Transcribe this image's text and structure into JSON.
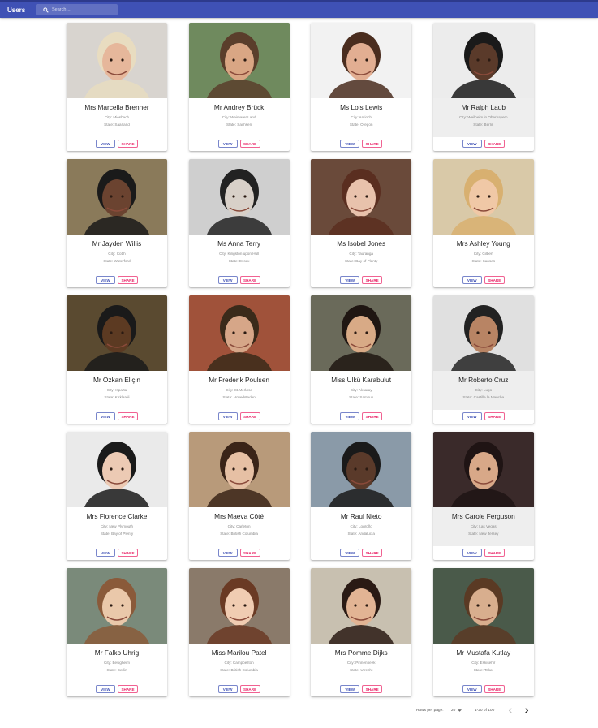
{
  "app": {
    "title": "Users"
  },
  "search": {
    "placeholder": "Search…",
    "value": ""
  },
  "colors": {
    "appbar": "#3f51b5",
    "view": "#3f51b5",
    "share": "#e91e63"
  },
  "actions": {
    "view_label": "VIEW",
    "share_label": "SHARE"
  },
  "users": [
    {
      "name": "Mrs Marcella Brenner",
      "city": "City: Miesbach",
      "state": "State: Saarland"
    },
    {
      "name": "Mr Andrey Brück",
      "city": "City: Weimarer Land",
      "state": "State: Sachsen"
    },
    {
      "name": "Ms Lois Lewis",
      "city": "City: Antioch",
      "state": "State: Oregon"
    },
    {
      "name": "Mr Ralph Laub",
      "city": "City: Weilheim in Oberbayern",
      "state": "State: Berlin"
    },
    {
      "name": "Mr Jayden Willis",
      "city": "City: Cobh",
      "state": "State: Waterford"
    },
    {
      "name": "Ms Anna Terry",
      "city": "City: Kingston upon Hull",
      "state": "State: Essex"
    },
    {
      "name": "Ms Isobel Jones",
      "city": "City: Tauranga",
      "state": "State: Bay of Plenty"
    },
    {
      "name": "Mrs Ashley Young",
      "city": "City: Gilbert",
      "state": "State: Kansas"
    },
    {
      "name": "Mr Özkan Eliçin",
      "city": "City: Isparta",
      "state": "State: Kırklareli"
    },
    {
      "name": "Mr Frederik Poulsen",
      "city": "City: St.Merløse",
      "state": "State: Hovedstaden"
    },
    {
      "name": "Miss Ülkü Karabulut",
      "city": "City: Aksaray",
      "state": "State: Samsun"
    },
    {
      "name": "Mr Roberto Cruz",
      "city": "City: Lugo",
      "state": "State: Castilla la Mancha"
    },
    {
      "name": "Mrs Florence Clarke",
      "city": "City: New Plymouth",
      "state": "State: Bay of Plenty"
    },
    {
      "name": "Mrs Maeva Côté",
      "city": "City: Carleton",
      "state": "State: British Columbia"
    },
    {
      "name": "Mr Raul Nieto",
      "city": "City: Logroño",
      "state": "State: Andalucía"
    },
    {
      "name": "Mrs Carole Ferguson",
      "city": "City: Las Vegas",
      "state": "State: New Jersey"
    },
    {
      "name": "Mr Falko Uhrig",
      "city": "City: Besigheim",
      "state": "State: Berlin"
    },
    {
      "name": "Miss Marilou Patel",
      "city": "City: Campbellton",
      "state": "State: British Columbia"
    },
    {
      "name": "Mrs Pomme Dijks",
      "city": "City: Pinnenbeek",
      "state": "State: Utrecht"
    },
    {
      "name": "Mr Mustafa Kutlay",
      "city": "City: Eskişehir",
      "state": "State: Tokat"
    }
  ],
  "pagination": {
    "rows_label": "Rows per page:",
    "rows_value": "20",
    "range": "1-20 of 100",
    "prev_icon": "chevron-left-icon",
    "next_icon": "chevron-right-icon"
  }
}
